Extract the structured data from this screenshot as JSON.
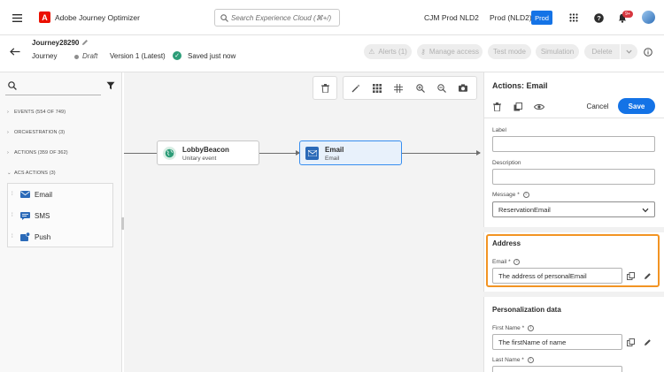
{
  "topbar": {
    "app_title": "Adobe Journey Optimizer",
    "logo_letter": "A",
    "search_placeholder": "Search Experience Cloud (⌘+/)",
    "org_name": "CJM Prod NLD2",
    "sandbox_name": "Prod (NLD2)",
    "sandbox_badge": "Prod",
    "notification_count": "9+"
  },
  "journey": {
    "name": "Journey28290",
    "type": "Journey",
    "status": "Draft",
    "version": "Version 1 (Latest)",
    "save_status": "Saved just now",
    "buttons": {
      "alerts": "Alerts (1)",
      "manage_access": "Manage access",
      "test_mode": "Test mode",
      "simulation": "Simulation",
      "delete": "Delete"
    }
  },
  "left_panel": {
    "categories": [
      {
        "label": "EVENTS (554 OF 749)",
        "expanded": false
      },
      {
        "label": "ORCHESTRATION (3)",
        "expanded": false
      },
      {
        "label": "ACTIONS (359 OF 362)",
        "expanded": false
      },
      {
        "label": "ACS ACTIONS (3)",
        "expanded": true
      }
    ],
    "acs_actions": [
      {
        "label": "Email",
        "icon": "email-icon"
      },
      {
        "label": "SMS",
        "icon": "sms-icon"
      },
      {
        "label": "Push",
        "icon": "push-icon"
      }
    ]
  },
  "canvas": {
    "nodes": [
      {
        "title": "LobbyBeacon",
        "subtitle": "Unitary event",
        "icon": "globe-icon"
      },
      {
        "title": "Email",
        "subtitle": "Email",
        "icon": "email-icon"
      }
    ]
  },
  "right_panel": {
    "title": "Actions: Email",
    "cancel_label": "Cancel",
    "save_label": "Save",
    "label_field": {
      "label": "Label",
      "value": ""
    },
    "description_field": {
      "label": "Description",
      "value": ""
    },
    "message_field": {
      "label": "Message",
      "required_mark": "*",
      "value": "ReservationEmail"
    },
    "address_section": {
      "title": "Address",
      "email_label": "Email",
      "required_mark": "*",
      "email_value": "The address of personalEmail"
    },
    "personalization_section": {
      "title": "Personalization data",
      "first_name_label": "First Name",
      "first_name_value": "The firstName of name",
      "last_name_label": "Last Name",
      "required_mark": "*"
    }
  },
  "colors": {
    "accent": "#1473e6",
    "highlight": "#f29423",
    "adobe_red": "#eb1000",
    "success": "#2d9d78"
  }
}
